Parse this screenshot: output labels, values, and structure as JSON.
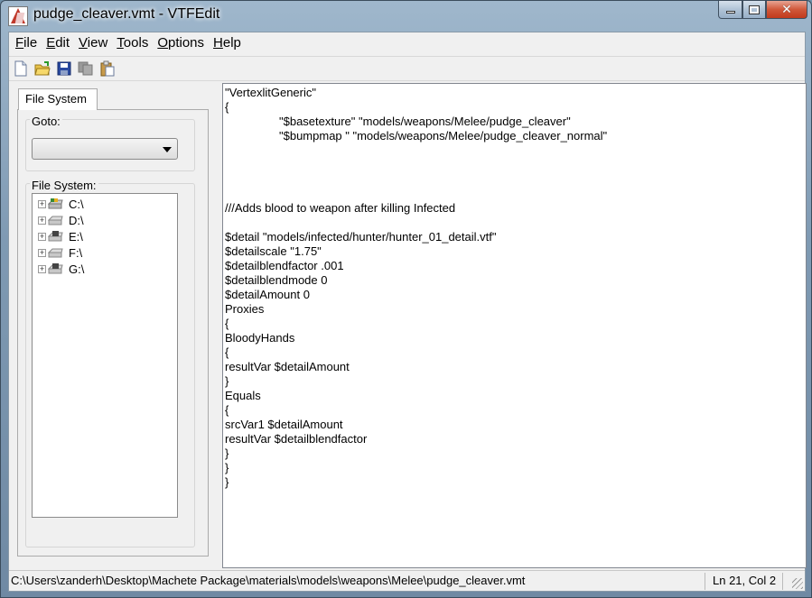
{
  "window": {
    "title": "pudge_cleaver.vmt - VTFEdit",
    "app_icon": "vtfedit-icon",
    "controls": {
      "minimize": "minimize",
      "maximize": "maximize",
      "close": "✕"
    }
  },
  "menubar": {
    "items": [
      {
        "label": "File",
        "accel": "F",
        "rest": "ile"
      },
      {
        "label": "Edit",
        "accel": "E",
        "rest": "dit"
      },
      {
        "label": "View",
        "accel": "V",
        "rest": "iew"
      },
      {
        "label": "Tools",
        "accel": "T",
        "rest": "ools"
      },
      {
        "label": "Options",
        "accel": "O",
        "rest": "ptions"
      },
      {
        "label": "Help",
        "accel": "H",
        "rest": "elp"
      }
    ]
  },
  "toolbar": {
    "buttons": [
      "new-file-icon",
      "open-folder-icon",
      "save-icon",
      "copy-icon",
      "paste-icon"
    ]
  },
  "left_panel": {
    "tab_label": "File System",
    "goto_label": "Goto:",
    "goto_value": "",
    "filesystem_label": "File System:",
    "drives": [
      {
        "label": "C:\\",
        "icon": "system-drive-icon"
      },
      {
        "label": "D:\\",
        "icon": "hard-drive-icon"
      },
      {
        "label": "E:\\",
        "icon": "optical-drive-icon"
      },
      {
        "label": "F:\\",
        "icon": "hard-drive-icon"
      },
      {
        "label": "G:\\",
        "icon": "optical-drive-icon"
      }
    ]
  },
  "editor": {
    "lines": [
      {
        "text": "\"VertexlitGeneric\"",
        "indent": false
      },
      {
        "text": "{",
        "indent": false
      },
      {
        "text": "\"$basetexture\" \"models/weapons/Melee/pudge_cleaver\"",
        "indent": true
      },
      {
        "text": "\"$bumpmap \" \"models/weapons/Melee/pudge_cleaver_normal\"",
        "indent": true
      },
      {
        "text": "",
        "indent": false
      },
      {
        "text": "",
        "indent": false
      },
      {
        "text": "",
        "indent": false
      },
      {
        "text": "",
        "indent": false
      },
      {
        "text": "///Adds blood to weapon after killing Infected",
        "indent": false
      },
      {
        "text": "",
        "indent": false
      },
      {
        "text": "$detail \"models/infected/hunter/hunter_01_detail.vtf\"",
        "indent": false
      },
      {
        "text": "$detailscale \"1.75\"",
        "indent": false
      },
      {
        "text": "$detailblendfactor .001",
        "indent": false
      },
      {
        "text": "$detailblendmode 0",
        "indent": false
      },
      {
        "text": "$detailAmount 0",
        "indent": false
      },
      {
        "text": "Proxies",
        "indent": false
      },
      {
        "text": "{",
        "indent": false
      },
      {
        "text": "BloodyHands",
        "indent": false
      },
      {
        "text": "{",
        "indent": false
      },
      {
        "text": "resultVar $detailAmount",
        "indent": false
      },
      {
        "text": "}",
        "indent": false
      },
      {
        "text": "Equals",
        "indent": false
      },
      {
        "text": "{",
        "indent": false
      },
      {
        "text": "srcVar1 $detailAmount",
        "indent": false
      },
      {
        "text": "resultVar $detailblendfactor",
        "indent": false
      },
      {
        "text": "}",
        "indent": false
      },
      {
        "text": "}",
        "indent": false
      },
      {
        "text": "}",
        "indent": false
      }
    ]
  },
  "statusbar": {
    "path": "C:\\Users\\zanderh\\Desktop\\Machete Package\\materials\\models\\weapons\\Melee\\pudge_cleaver.vmt",
    "position": "Ln 21, Col 2"
  }
}
